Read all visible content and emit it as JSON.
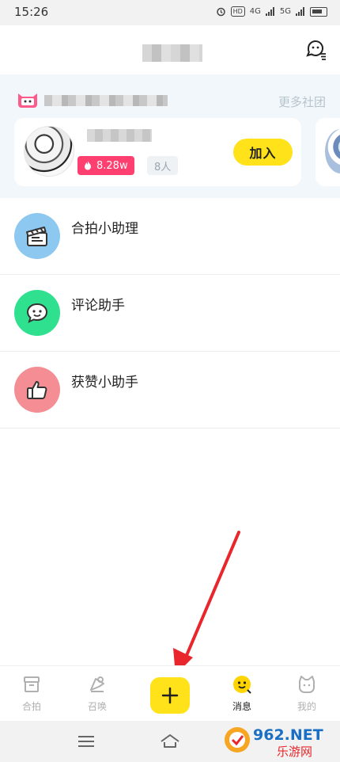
{
  "status_bar": {
    "time": "15:26",
    "indicators": [
      "alarm-icon",
      "HD",
      "4G",
      "5G",
      "battery-icon"
    ],
    "battery_label": "46"
  },
  "header": {
    "title": "",
    "chat_icon": "chat-bubble-icon"
  },
  "community": {
    "more_label": "更多社团",
    "card": {
      "heat": "8.28w",
      "members": "8人",
      "join_label": "加入"
    }
  },
  "messages": [
    {
      "label": "合拍小助理",
      "icon": "clapperboard-icon",
      "color": "#8cc8f0"
    },
    {
      "label": "评论助手",
      "icon": "comment-bubble-icon",
      "color": "#2fe08f"
    },
    {
      "label": "获赞小助手",
      "icon": "thumbs-up-icon",
      "color": "#f48e94"
    }
  ],
  "tabbar": {
    "tabs": [
      {
        "label": "合拍",
        "icon": "archive-box-icon",
        "active": false
      },
      {
        "label": "召唤",
        "icon": "summon-icon",
        "active": false
      },
      {
        "label": "",
        "icon": "plus-icon",
        "active": false
      },
      {
        "label": "消息",
        "icon": "message-face-icon",
        "active": true
      },
      {
        "label": "我的",
        "icon": "cat-face-icon",
        "active": false
      }
    ]
  },
  "watermark": {
    "text_main": "962.NET",
    "text_sub": "乐游网"
  },
  "colors": {
    "accent_yellow": "#ffe21a",
    "hot_pink": "#ff3f6f",
    "annotation_red": "#e8262b"
  }
}
